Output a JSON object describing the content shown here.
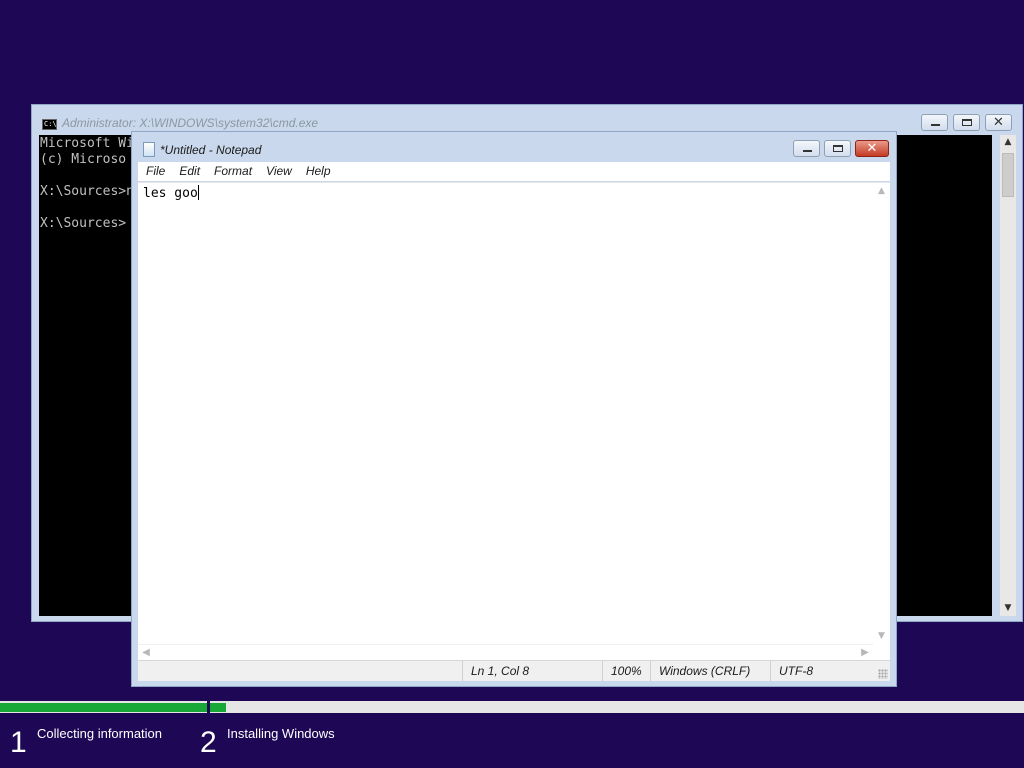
{
  "cmd": {
    "title": "Administrator: X:\\WINDOWS\\system32\\cmd.exe",
    "icon_text": "C:\\",
    "lines": [
      "Microsoft Wi",
      "(c) Microso",
      "",
      "X:\\Sources>n",
      "",
      "X:\\Sources>"
    ],
    "scroll_up": "▲",
    "scroll_down": "▼"
  },
  "notepad": {
    "title": "*Untitled - Notepad",
    "menu": [
      "File",
      "Edit",
      "Format",
      "View",
      "Help"
    ],
    "content": "les goo",
    "status": {
      "position": "Ln 1, Col 8",
      "zoom": "100%",
      "line_endings": "Windows (CRLF)",
      "encoding": "UTF-8"
    },
    "scroll_up": "▲",
    "scroll_down": "▼",
    "scroll_left": "◀",
    "scroll_right": "▶"
  },
  "window_buttons": {
    "minimize": "",
    "maximize": "",
    "close": "✕"
  },
  "setup": {
    "steps": [
      {
        "number": "1",
        "label": "Collecting information"
      },
      {
        "number": "2",
        "label": "Installing Windows"
      }
    ],
    "progress": {
      "step1_fraction": 1.0,
      "step2_fraction": 0.02
    }
  },
  "colors": {
    "desktop": "#1e0856",
    "progress_fill": "#17a838"
  }
}
